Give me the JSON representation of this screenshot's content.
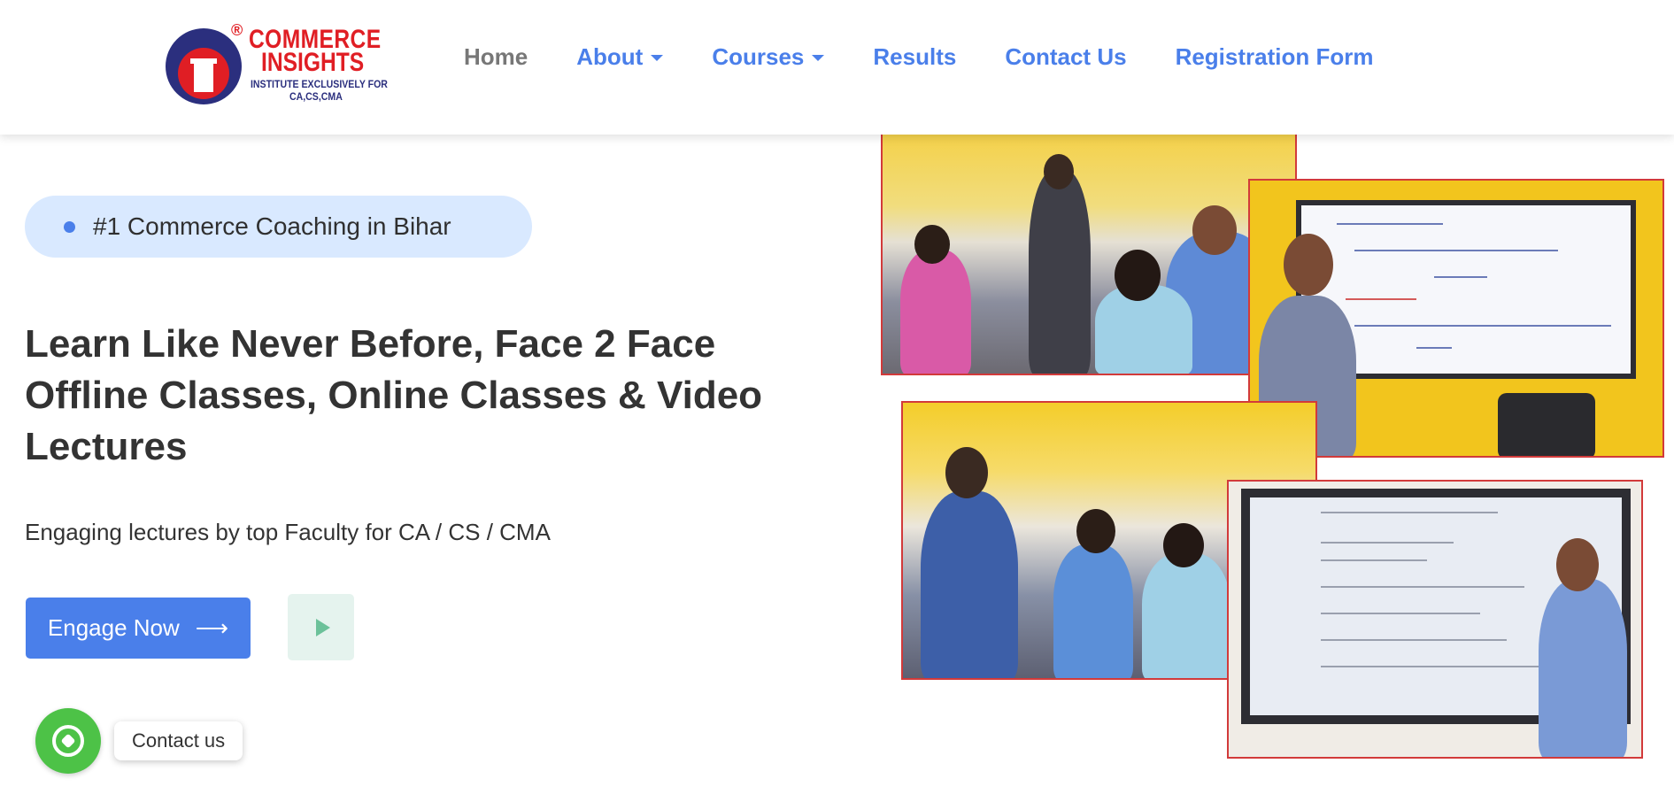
{
  "brand": {
    "name_line1": "COMMERCE",
    "name_line2": "INSIGHTS",
    "tagline_line1": "INSTITUTE EXCLUSIVELY FOR",
    "tagline_line2": "CA,CS,CMA",
    "registered_mark": "®",
    "colors": {
      "red": "#e01e24",
      "navy": "#2b2f7e"
    }
  },
  "nav": {
    "items": [
      {
        "label": "Home",
        "active": true,
        "dropdown": false
      },
      {
        "label": "About",
        "active": false,
        "dropdown": true
      },
      {
        "label": "Courses",
        "active": false,
        "dropdown": true
      },
      {
        "label": "Results",
        "active": false,
        "dropdown": false
      },
      {
        "label": "Contact Us",
        "active": false,
        "dropdown": false
      },
      {
        "label": "Registration Form",
        "active": false,
        "dropdown": false
      }
    ],
    "link_color": "#4a7fea",
    "active_color": "#777777"
  },
  "hero": {
    "badge": "#1 Commerce Coaching in Bihar",
    "headline_line1": "Learn Like Never Before, Face 2 Face",
    "headline_line2": "Offline Classes, Online Classes & Video",
    "headline_line3": "Lectures",
    "subtitle": "Engaging lectures by top Faculty for CA / CS / CMA",
    "cta_label": "Engage Now",
    "cta_icon": "arrow-right-icon",
    "play_icon": "play-icon",
    "accent": "#4a7fea"
  },
  "whatsapp": {
    "label": "Contact us",
    "icon": "whatsapp-icon",
    "color": "#4dc247"
  },
  "gallery": {
    "images": [
      {
        "subject": "classroom-students-1"
      },
      {
        "subject": "teacher-at-whiteboard-1"
      },
      {
        "subject": "classroom-students-2"
      },
      {
        "subject": "teacher-at-smartboard-2"
      }
    ]
  }
}
